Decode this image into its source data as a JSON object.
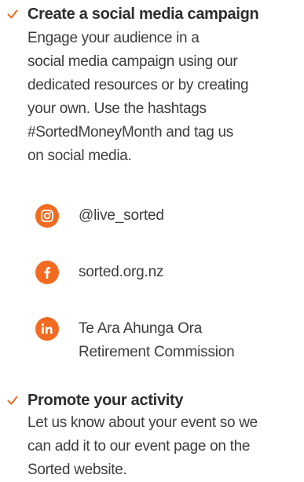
{
  "items": [
    {
      "heading": "Create a social media campaign",
      "lines": [
        "Engage your audience in a",
        "social media campaign using our",
        "dedicated resources or by creating",
        "your own. Use the hashtags",
        "#SortedMoneyMonth and tag us",
        "on social media."
      ]
    },
    {
      "heading": "Promote your activity",
      "lines": [
        "Let us know about your event so we",
        "can add it to our event page on the",
        "Sorted website."
      ]
    }
  ],
  "social": [
    {
      "icon": "instagram-icon",
      "lines": [
        "@live_sorted"
      ]
    },
    {
      "icon": "facebook-icon",
      "lines": [
        "sorted.org.nz"
      ]
    },
    {
      "icon": "linkedin-icon",
      "lines": [
        "Te Ara Ahunga Ora",
        "Retirement Commission"
      ]
    }
  ],
  "colors": {
    "accent": "#f26b21",
    "text": "#3d3d3d",
    "heading": "#2d2d2d",
    "background": "#ffffff"
  }
}
